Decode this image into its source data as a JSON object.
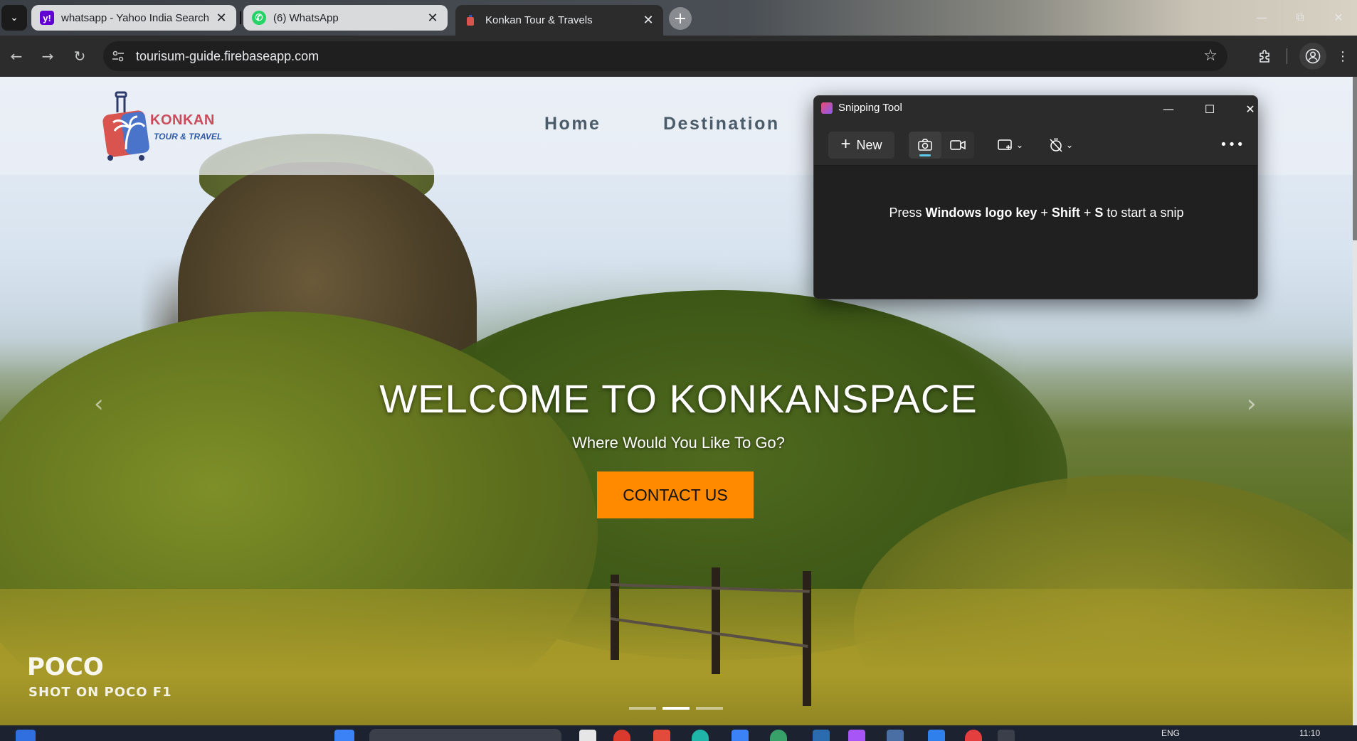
{
  "browser": {
    "tabs": [
      {
        "label": "whatsapp - Yahoo India Search",
        "favicon": "yahoo-icon",
        "active": false
      },
      {
        "label": "(6) WhatsApp",
        "favicon": "whatsapp-icon",
        "active": false
      },
      {
        "label": "Konkan Tour & Travels",
        "favicon": "konkan-favicon",
        "active": true
      }
    ],
    "new_tab_label": "+",
    "url": "tourisum-guide.firebaseapp.com"
  },
  "site": {
    "logo": {
      "main": "KONKAN",
      "sub": "TOUR & TRAVEL"
    },
    "nav": [
      {
        "label": "Home"
      },
      {
        "label": "Destination"
      }
    ],
    "hero": {
      "title": "WELCOME TO KONKANSPACE",
      "subtitle": "Where Would You Like To Go?",
      "button": "CONTACT US",
      "slides_total": 3,
      "active_slide": 2
    },
    "photo_watermark": {
      "brand": "POCO",
      "caption": "SHOT ON POCO F1"
    }
  },
  "snipping_tool": {
    "title": "Snipping Tool",
    "new_label": "New",
    "hint_pre": "Press ",
    "hint_key1": "Windows logo key",
    "hint_plus1": " + ",
    "hint_key2": "Shift",
    "hint_plus2": " + ",
    "hint_key3": "S",
    "hint_post": " to start a snip"
  },
  "taskbar": {
    "language": "ENG",
    "time": "11:10"
  },
  "colors": {
    "accent_button": "#ff8a00",
    "browser_chrome": "#2c2c2c",
    "snip_bg": "#202020",
    "logo_red": "#c94c5a",
    "logo_blue": "#2e5aa8",
    "nav_text": "#4a5c6a"
  }
}
